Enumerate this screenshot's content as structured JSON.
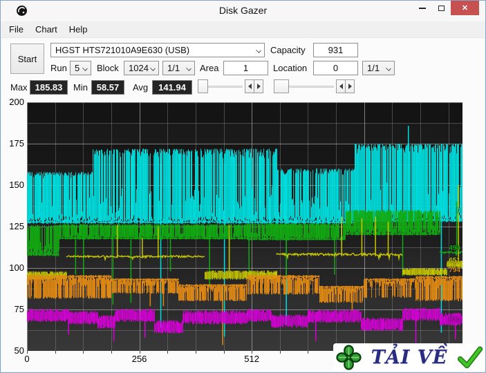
{
  "window": {
    "title": "Disk Gazer",
    "close_glyph": "✕"
  },
  "menu": {
    "items": [
      "File",
      "Chart",
      "Help"
    ]
  },
  "toolbar": {
    "start_label": "Start",
    "drive_select": {
      "value": "HGST HTS721010A9E630 (USB)"
    },
    "capacity": {
      "label": "Capacity",
      "value": "931"
    },
    "run": {
      "label": "Run",
      "value": "5"
    },
    "block": {
      "label": "Block",
      "value": "1024",
      "sub_value": "1/1"
    },
    "area": {
      "label": "Area",
      "value": "1"
    },
    "location": {
      "label": "Location",
      "value": "0",
      "sub_value": "1/1"
    }
  },
  "stats": {
    "max": {
      "label": "Max",
      "value": "185.83"
    },
    "min": {
      "label": "Min",
      "value": "58.57"
    },
    "avg": {
      "label": "Avg",
      "value": "141.94"
    }
  },
  "watermark": {
    "text": "TẢI VỀ",
    "clover_color": "#2f9e33",
    "check_color": "#44c326",
    "text_color": "#2b2b80"
  },
  "chart_data": {
    "type": "line",
    "title": "",
    "xlabel": "",
    "ylabel": "",
    "xlim": [
      0,
      992
    ],
    "ylim": [
      50,
      200
    ],
    "x_ticks": [
      0,
      256,
      512
    ],
    "y_ticks": [
      200,
      175,
      150,
      125,
      100,
      75,
      50
    ],
    "grid": {
      "x_minor_step": 64,
      "x_major_step": 256,
      "y_minor_step": 12.5,
      "y_major_step": 25,
      "grid_on": true
    },
    "legend_position": "right-edge-inside",
    "stats": {
      "max": 185.83,
      "min": 58.57,
      "avg": 141.94
    },
    "series": [
      {
        "name": "0",
        "color": "#00dfdf",
        "label_v": 134,
        "segments": [
          {
            "x0": 0,
            "x1": 150,
            "lo": 127,
            "hi": 158,
            "mode": "up",
            "density": 0.82
          },
          {
            "x0": 150,
            "x1": 568,
            "lo": 127,
            "hi": 172,
            "mode": "up",
            "density": 0.82
          },
          {
            "x0": 568,
            "x1": 744,
            "lo": 127,
            "hi": 160,
            "mode": "up",
            "density": 0.82
          },
          {
            "x0": 744,
            "x1": 992,
            "lo": 128,
            "hi": 175,
            "mode": "up",
            "density": 0.82
          }
        ],
        "spikes": [
          {
            "x": 304,
            "v": 64
          },
          {
            "x": 449,
            "v": 58.6
          },
          {
            "x": 590,
            "v": 66
          },
          {
            "x": 868,
            "v": 185.8
          },
          {
            "x": 943,
            "v": 61
          }
        ]
      },
      {
        "name": "494",
        "color": "#12aa12",
        "label_v": 111.5,
        "segments": [
          {
            "x0": 0,
            "x1": 72,
            "lo": 107.5,
            "hi": 126,
            "mode": "up",
            "density": 0.85
          },
          {
            "x0": 72,
            "x1": 500,
            "lo": 117.5,
            "hi": 126.5,
            "mode": "up",
            "density": 0.9
          },
          {
            "x0": 500,
            "x1": 724,
            "lo": 117,
            "hi": 127,
            "mode": "up",
            "density": 0.9
          },
          {
            "x0": 724,
            "x1": 940,
            "lo": 120,
            "hi": 135,
            "mode": "up",
            "density": 0.85
          },
          {
            "x0": 940,
            "x1": 992,
            "lo": 108,
            "hi": 110.5,
            "mode": "line"
          }
        ],
        "spikes": [
          {
            "x": 110,
            "v": 96
          },
          {
            "x": 128,
            "v": 90
          },
          {
            "x": 195,
            "v": 78
          },
          {
            "x": 236,
            "v": 79
          },
          {
            "x": 326,
            "v": 98
          },
          {
            "x": 415,
            "v": 90
          },
          {
            "x": 505,
            "v": 96
          },
          {
            "x": 590,
            "v": 95
          },
          {
            "x": 700,
            "v": 96
          },
          {
            "x": 855,
            "v": 95
          },
          {
            "x": 978,
            "v": 140
          }
        ]
      },
      {
        "name": "651",
        "color": "#c9c900",
        "label_v": 104,
        "segments": [
          {
            "x0": 0,
            "x1": 90,
            "lo": 93,
            "hi": 98,
            "mode": "band"
          },
          {
            "x0": 90,
            "x1": 405,
            "lo": 105.5,
            "hi": 108,
            "mode": "line"
          },
          {
            "x0": 405,
            "x1": 568,
            "lo": 93,
            "hi": 98.5,
            "mode": "band"
          },
          {
            "x0": 568,
            "x1": 855,
            "lo": 106.5,
            "hi": 109.5,
            "mode": "line"
          },
          {
            "x0": 855,
            "x1": 955,
            "lo": 95.5,
            "hi": 100,
            "mode": "band"
          },
          {
            "x0": 955,
            "x1": 992,
            "lo": 100,
            "hi": 104.5,
            "mode": "band"
          }
        ],
        "spikes": [
          {
            "x": 205,
            "v": 126
          },
          {
            "x": 262,
            "v": 118
          },
          {
            "x": 298,
            "v": 125
          },
          {
            "x": 460,
            "v": 126
          },
          {
            "x": 716,
            "v": 131
          },
          {
            "x": 762,
            "v": 130
          },
          {
            "x": 793,
            "v": 131
          },
          {
            "x": 822,
            "v": 128
          },
          {
            "x": 982,
            "v": 150
          }
        ]
      },
      {
        "name": "794",
        "color": "#e18a14",
        "label_v": 98.5,
        "segments": [
          {
            "x0": 0,
            "x1": 190,
            "lo": 81.5,
            "hi": 95.5,
            "mode": "down",
            "density": 0.78
          },
          {
            "x0": 190,
            "x1": 345,
            "lo": 84.5,
            "hi": 93.5,
            "mode": "down",
            "density": 0.7
          },
          {
            "x0": 345,
            "x1": 500,
            "lo": 80,
            "hi": 90,
            "mode": "down",
            "density": 0.75
          },
          {
            "x0": 500,
            "x1": 664,
            "lo": 84,
            "hi": 95.5,
            "mode": "down",
            "density": 0.7
          },
          {
            "x0": 664,
            "x1": 767,
            "lo": 79,
            "hi": 89,
            "mode": "down",
            "density": 0.8
          },
          {
            "x0": 767,
            "x1": 885,
            "lo": 82,
            "hi": 93.5,
            "mode": "down",
            "density": 0.5
          },
          {
            "x0": 885,
            "x1": 992,
            "lo": 80,
            "hi": 95,
            "mode": "down",
            "density": 0.8
          }
        ],
        "spikes": [
          {
            "x": 280,
            "v": 77
          },
          {
            "x": 310,
            "v": 77
          },
          {
            "x": 445,
            "v": 53.5
          },
          {
            "x": 740,
            "v": 74
          }
        ]
      },
      {
        "name": "930",
        "color": "#d800d8",
        "label_v": 68.5,
        "segments": [
          {
            "x0": 0,
            "x1": 95,
            "lo": 67.5,
            "hi": 75.5,
            "mode": "band"
          },
          {
            "x0": 95,
            "x1": 160,
            "lo": 66,
            "hi": 74,
            "mode": "band"
          },
          {
            "x0": 160,
            "x1": 200,
            "lo": 63.5,
            "hi": 71.5,
            "mode": "band"
          },
          {
            "x0": 200,
            "x1": 290,
            "lo": 67.5,
            "hi": 75.5,
            "mode": "band"
          },
          {
            "x0": 290,
            "x1": 355,
            "lo": 60.5,
            "hi": 68.5,
            "mode": "band"
          },
          {
            "x0": 355,
            "x1": 500,
            "lo": 66,
            "hi": 74.5,
            "mode": "band"
          },
          {
            "x0": 500,
            "x1": 556,
            "lo": 67.5,
            "hi": 75.5,
            "mode": "band"
          },
          {
            "x0": 556,
            "x1": 640,
            "lo": 64,
            "hi": 72,
            "mode": "band"
          },
          {
            "x0": 640,
            "x1": 760,
            "lo": 67,
            "hi": 75,
            "mode": "band"
          },
          {
            "x0": 760,
            "x1": 855,
            "lo": 62,
            "hi": 70,
            "mode": "band"
          },
          {
            "x0": 855,
            "x1": 940,
            "lo": 68,
            "hi": 76,
            "mode": "band"
          },
          {
            "x0": 940,
            "x1": 992,
            "lo": 65,
            "hi": 73,
            "mode": "band"
          }
        ],
        "spikes": [
          {
            "x": 94,
            "v": 60
          },
          {
            "x": 197,
            "v": 55.8
          },
          {
            "x": 268,
            "v": 58
          },
          {
            "x": 657,
            "v": 56
          },
          {
            "x": 885,
            "v": 49
          },
          {
            "x": 975,
            "v": 57
          }
        ]
      }
    ]
  }
}
